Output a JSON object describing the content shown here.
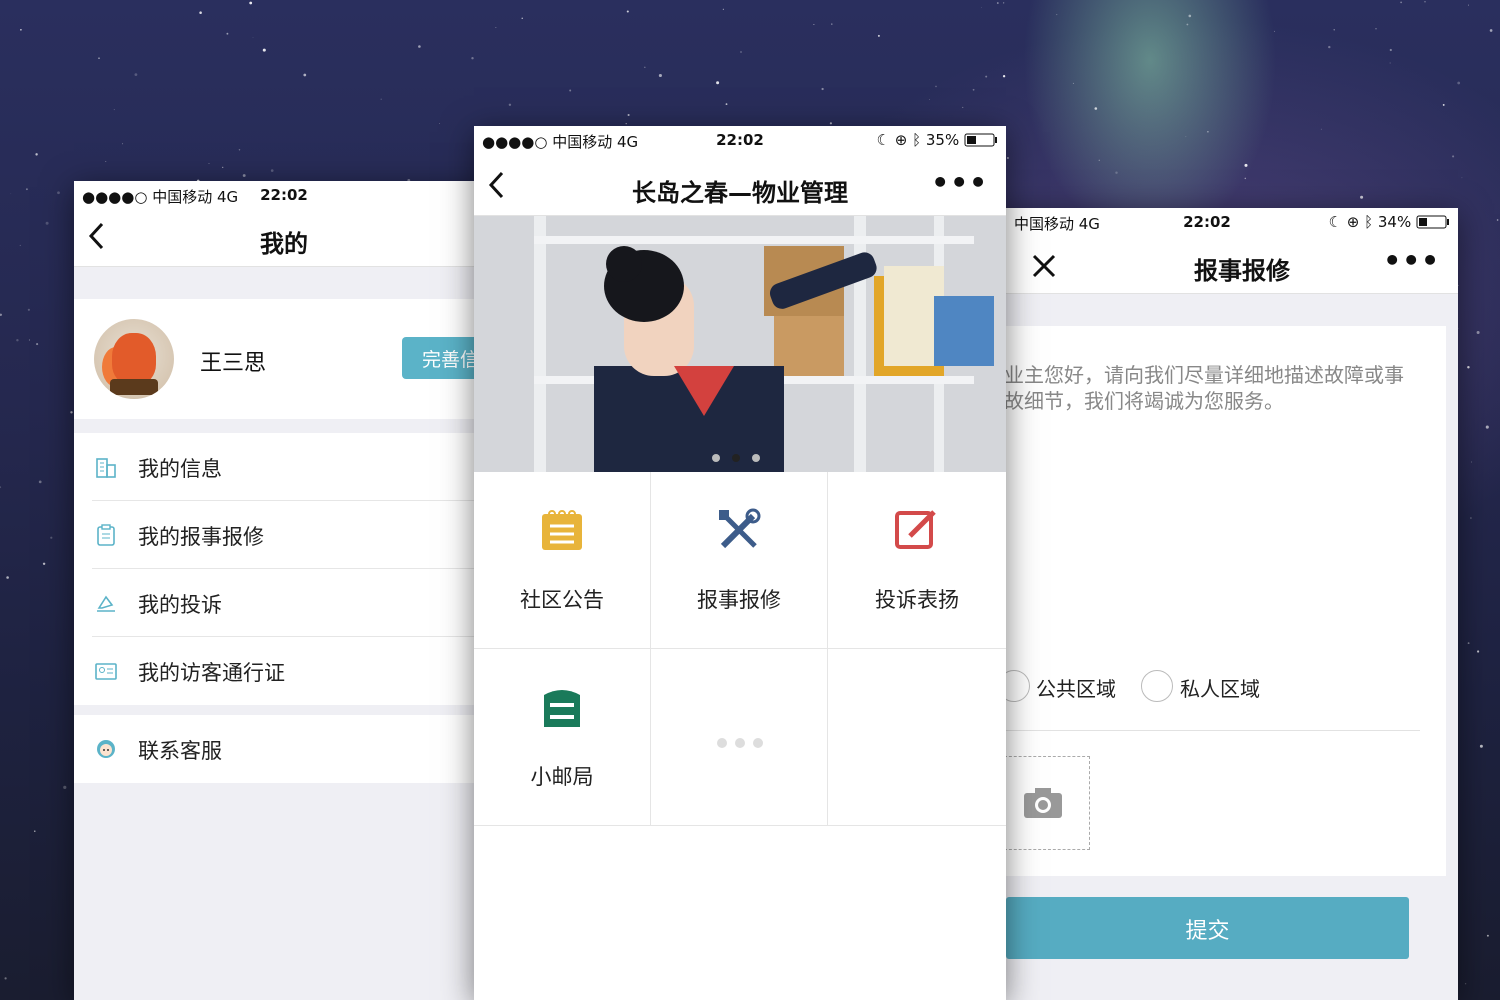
{
  "left_phone": {
    "status": {
      "carrier": "●●●●○ 中国移动   4G",
      "time": "22:02",
      "right": "☾ ⊕"
    },
    "title": "我的",
    "back_icon": "chevron-left-icon",
    "profile": {
      "name": "王三思",
      "button_label": "完善信"
    },
    "menu": [
      {
        "label": "我的信息",
        "icon": "building-icon"
      },
      {
        "label": "我的报事报修",
        "icon": "clipboard-icon"
      },
      {
        "label": "我的投诉",
        "icon": "complaint-icon"
      },
      {
        "label": "我的访客通行证",
        "icon": "id-card-icon"
      }
    ],
    "service": {
      "label": "联系客服",
      "icon": "customer-service-icon"
    }
  },
  "center_phone": {
    "status": {
      "carrier": "●●●●○ 中国移动   4G",
      "time": "22:02",
      "battery": "35%"
    },
    "title": "长岛之春—物业管理",
    "more": "•••",
    "banner": {
      "total": 3,
      "active_index": 1
    },
    "grid": [
      {
        "label": "社区公告",
        "icon": "notepad-icon",
        "color": "#e8b43a"
      },
      {
        "label": "报事报修",
        "icon": "tools-icon",
        "color": "#3d5c8a"
      },
      {
        "label": "投诉表扬",
        "icon": "edit-icon",
        "color": "#d34a4a"
      },
      {
        "label": "小邮局",
        "icon": "mailbox-icon",
        "color": "#1a7a5a"
      },
      {
        "label": "",
        "icon": "more-dots-icon"
      },
      {
        "label": "",
        "icon": ""
      }
    ]
  },
  "right_phone": {
    "status": {
      "carrier": "中国移动   4G",
      "time": "22:02",
      "battery": "34%"
    },
    "title": "报事报修",
    "more": "•••",
    "description": "业主您好，请向我们尽量详细地描述故障或事故细节，我们将竭诚为您服务。",
    "options": [
      "公共区域",
      "私人区域"
    ],
    "submit_label": "提交"
  },
  "colors": {
    "accent": "#56acc2",
    "background_panel": "#efeff4"
  }
}
